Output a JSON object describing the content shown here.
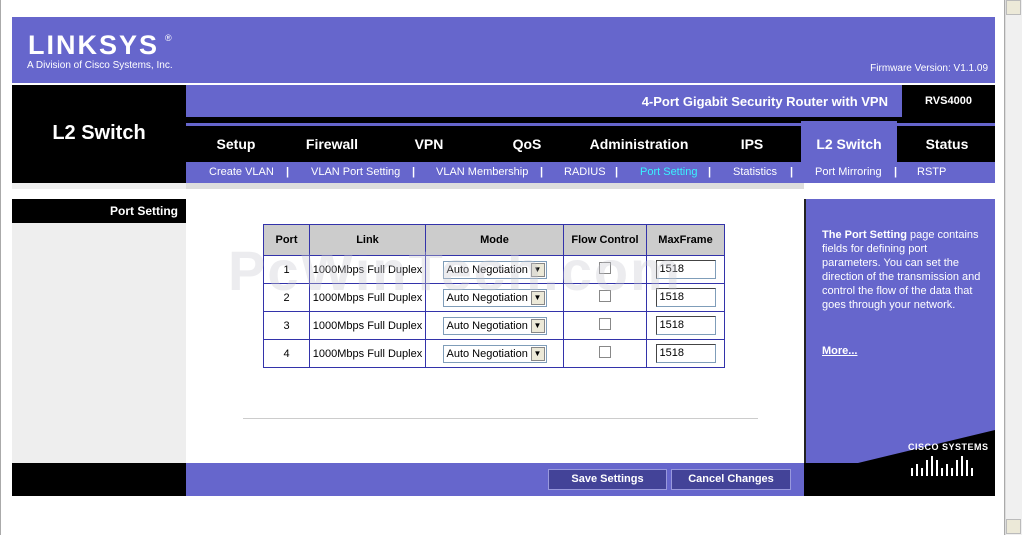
{
  "brand": {
    "logo": "LINKSYS",
    "registered": "®",
    "subtitle": "A Division of Cisco Systems, Inc.",
    "firmware": "Firmware Version: V1.1.09"
  },
  "section_title": "L2 Switch",
  "product": {
    "name": "4-Port Gigabit Security Router with VPN",
    "model": "RVS4000"
  },
  "tabs": [
    {
      "label": "Setup"
    },
    {
      "label": "Firewall"
    },
    {
      "label": "VPN"
    },
    {
      "label": "QoS"
    },
    {
      "label": "Administration"
    },
    {
      "label": "IPS"
    },
    {
      "label": "L2 Switch"
    },
    {
      "label": "Status"
    }
  ],
  "subtabs": [
    {
      "label": "Create VLAN"
    },
    {
      "label": "VLAN Port Setting"
    },
    {
      "label": "VLAN Membership"
    },
    {
      "label": "RADIUS"
    },
    {
      "label": "Port Setting"
    },
    {
      "label": "Statistics"
    },
    {
      "label": "Port Mirroring"
    },
    {
      "label": "RSTP"
    }
  ],
  "separator": "|",
  "left_nav": {
    "label": "Port Setting"
  },
  "table": {
    "headers": [
      "Port",
      "Link",
      "Mode",
      "Flow Control",
      "MaxFrame"
    ],
    "rows": [
      {
        "port": "1",
        "link": "1000Mbps Full Duplex",
        "mode": "Auto Negotiation",
        "flow": false,
        "maxframe": "1518"
      },
      {
        "port": "2",
        "link": "1000Mbps Full Duplex",
        "mode": "Auto Negotiation",
        "flow": false,
        "maxframe": "1518"
      },
      {
        "port": "3",
        "link": "1000Mbps Full Duplex",
        "mode": "Auto Negotiation",
        "flow": false,
        "maxframe": "1518"
      },
      {
        "port": "4",
        "link": "1000Mbps Full Duplex",
        "mode": "Auto Negotiation",
        "flow": false,
        "maxframe": "1518"
      }
    ]
  },
  "watermark": "PcWinTech.com",
  "help": {
    "title": "The Port Setting",
    "text": "page contains fields for defining port parameters. You can set the direction of the transmission and control the flow of the data that goes through your network.",
    "more": "More..."
  },
  "cisco": "CISCO SYSTEMS",
  "buttons": {
    "save": "Save Settings",
    "cancel": "Cancel Changes"
  },
  "colors": {
    "accent": "#6666cc",
    "active_subtab": "#39f3ff",
    "button": "#434398"
  }
}
